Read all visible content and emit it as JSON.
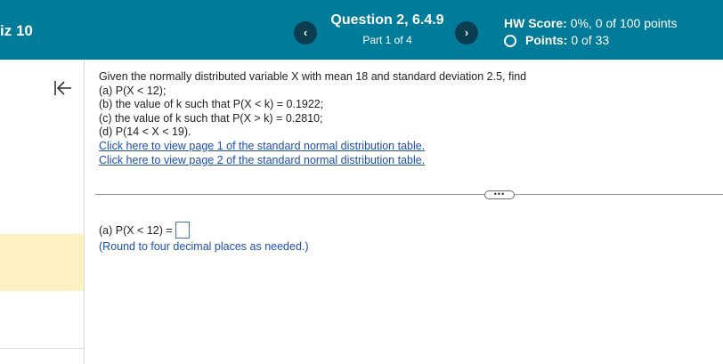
{
  "header": {
    "quiz_title": "iz 10",
    "prev_label": "‹",
    "next_label": "›",
    "question_title": "Question 2, 6.4.9",
    "question_part": "Part 1 of 4",
    "hw_score_label": "HW Score:",
    "hw_score_value": "0%, 0 of 100 points",
    "points_label": "Points:",
    "points_value": "0 of 33"
  },
  "question": {
    "lines": [
      "Given the normally distributed variable X with mean 18 and standard deviation 2.5, find",
      "(a) P(X < 12);",
      "(b) the value of k such that P(X < k) = 0.1922;",
      "(c) the value of k such that P(X > k) = 0.2810;",
      "(d) P(14 < X < 19)."
    ],
    "links": [
      "Click here to view page 1 of the standard normal distribution table.",
      "Click here to view page 2 of the standard normal distribution table."
    ]
  },
  "more_label": "•••",
  "answer": {
    "prompt": "(a) P(X < 12) =",
    "value": "",
    "hint": "(Round to four decimal places as needed.)"
  },
  "colors": {
    "header_bg": "#007b9a",
    "nav_button": "#0a3d4f",
    "link": "#1a4fb5",
    "sidebar_highlight": "#fdf0c3"
  }
}
